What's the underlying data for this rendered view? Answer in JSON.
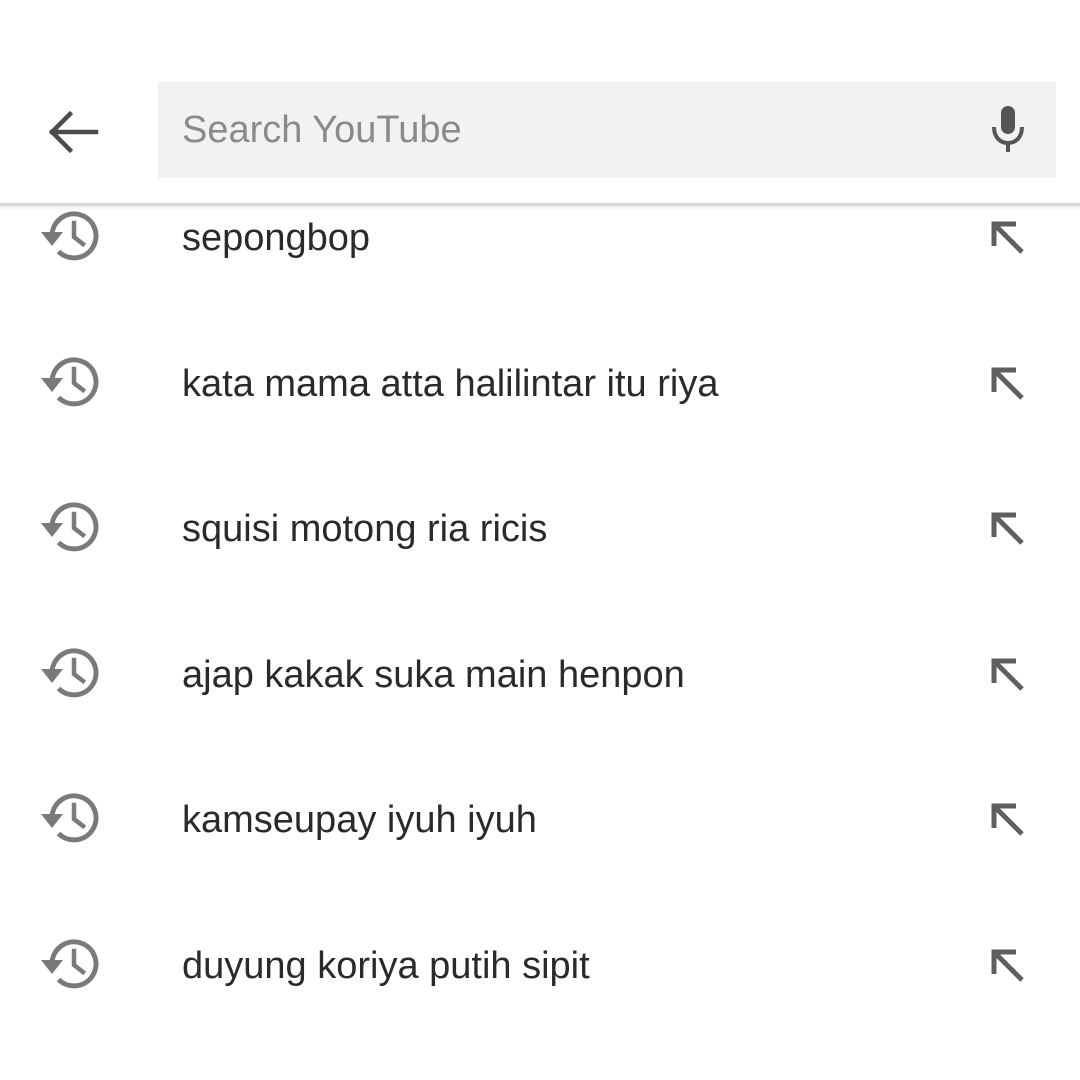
{
  "header": {
    "back_icon": "arrow-left-icon",
    "search": {
      "placeholder": "Search YouTube",
      "value": ""
    },
    "mic_icon": "microphone-icon"
  },
  "history": {
    "items": [
      {
        "label": "sepongbop",
        "icon": "history-icon",
        "action_icon": "arrow-up-left-icon"
      },
      {
        "label": "kata mama atta halilintar itu riya",
        "icon": "history-icon",
        "action_icon": "arrow-up-left-icon"
      },
      {
        "label": "squisi motong ria ricis",
        "icon": "history-icon",
        "action_icon": "arrow-up-left-icon"
      },
      {
        "label": "ajap kakak suka main henpon",
        "icon": "history-icon",
        "action_icon": "arrow-up-left-icon"
      },
      {
        "label": "kamseupay iyuh iyuh",
        "icon": "history-icon",
        "action_icon": "arrow-up-left-icon"
      },
      {
        "label": "duyung koriya putih sipit",
        "icon": "history-icon",
        "action_icon": "arrow-up-left-icon"
      }
    ]
  },
  "colors": {
    "icon": "#5f5f5f",
    "history_icon": "#7a7a7a",
    "text": "#2a2a2a",
    "placeholder": "#8a8a8a",
    "search_bg": "#f2f2f2"
  }
}
